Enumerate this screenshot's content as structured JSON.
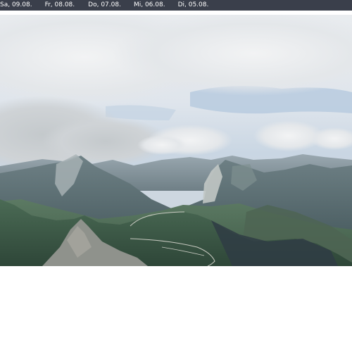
{
  "date_tabs": [
    {
      "label": "Sa, 09.08."
    },
    {
      "label": "Fr, 08.08."
    },
    {
      "label": "Do, 07.08."
    },
    {
      "label": "Mi, 06.08."
    },
    {
      "label": "Di, 05.08."
    }
  ],
  "colors": {
    "date_bar_bg": "#3a3f4b",
    "date_text": "#ffffff"
  },
  "image": {
    "subject": "mountain-panorama-webcam"
  }
}
